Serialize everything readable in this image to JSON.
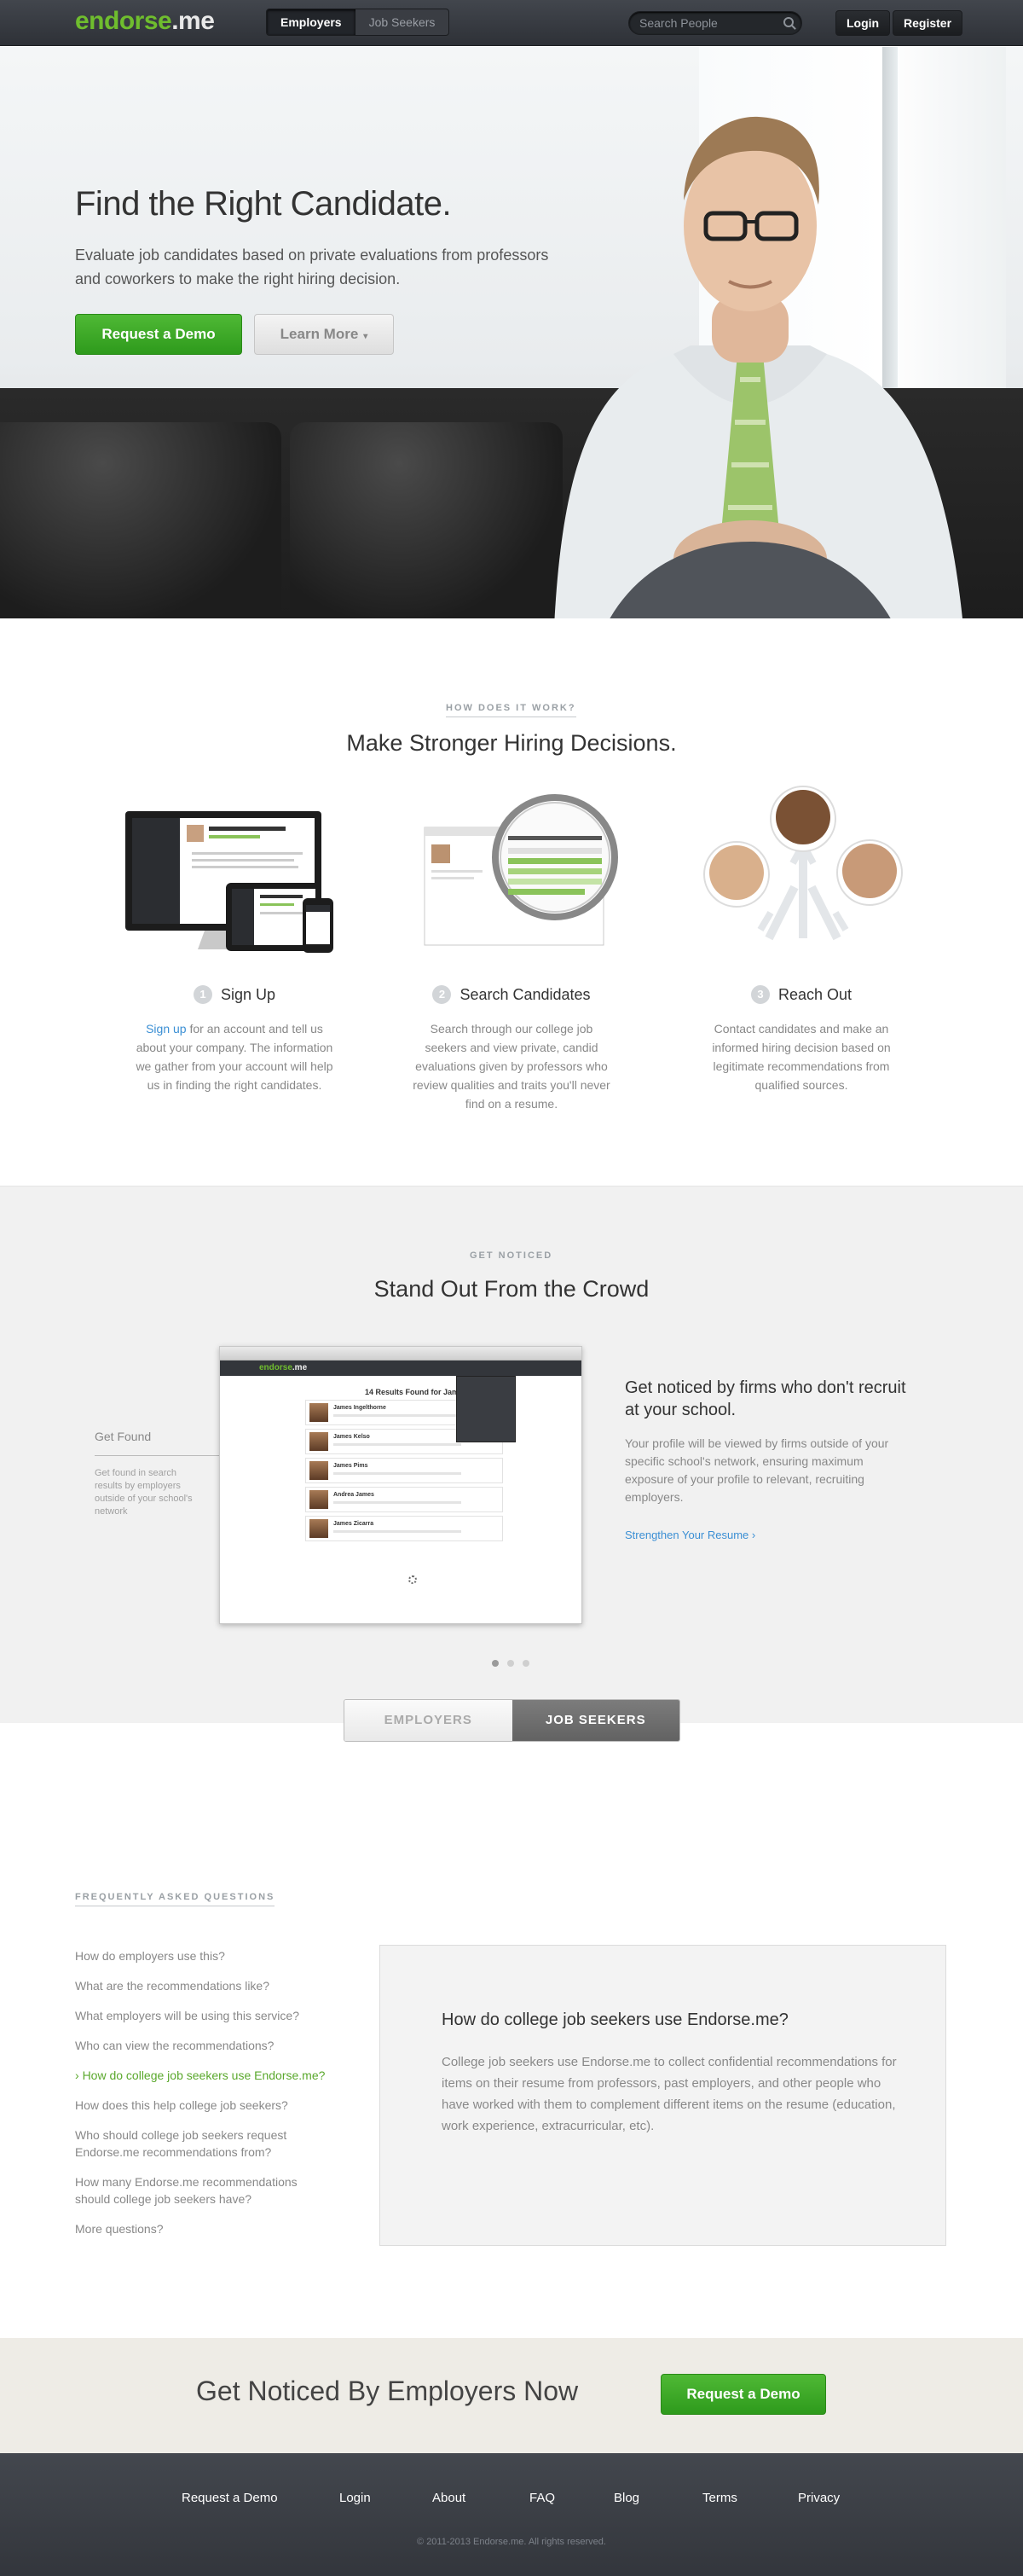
{
  "nav": {
    "logo_main": "endorse",
    "logo_dot": ".me",
    "tab_employers": "Employers",
    "tab_jobseekers": "Job Seekers",
    "search_placeholder": "Search People",
    "login": "Login",
    "register": "Register"
  },
  "hero": {
    "title": "Find the Right Candidate.",
    "subtitle": "Evaluate job candidates based on private evaluations from professors and coworkers to make the right hiring decision.",
    "demo_button": "Request a Demo",
    "learn_button": "Learn More"
  },
  "how": {
    "kicker": "HOW DOES IT WORK?",
    "title": "Make Stronger Hiring Decisions.",
    "steps": [
      {
        "num": "1",
        "title": "Sign Up",
        "link": "Sign up",
        "desc": " for an account and tell us about your company.  The information we gather from your account will help us in finding the right candidates."
      },
      {
        "num": "2",
        "title": "Search Candidates",
        "desc": "Search through our college job seekers and view private, candid evaluations given by professors who review qualities and traits you'll never find on a resume."
      },
      {
        "num": "3",
        "title": "Reach Out",
        "desc": "Contact candidates and make an informed hiring decision based on legitimate recommendations from qualified sources."
      }
    ]
  },
  "noticed": {
    "kicker": "GET NOTICED",
    "title": "Stand Out From the Crowd",
    "get_found": "Get Found",
    "get_found_desc": "Get found in search results by employers outside of your school's network",
    "mini_logo": "endorse",
    "mini_logo_dot": ".me",
    "results_title": "14 Results Found for James",
    "result_names": [
      "James Ingelthorne",
      "James Kelso",
      "James Pims",
      "Andrea James",
      "James Zicarra"
    ],
    "side_title": "Get noticed by firms who don't recruit at your school.",
    "side_desc": "Your profile will be viewed by firms outside of your specific school's network, ensuring maximum exposure of your profile to relevant, recruiting employers.",
    "side_link": "Strengthen Your Resume",
    "toggle_employers": "EMPLOYERS",
    "toggle_jobseekers": "JOB SEEKERS"
  },
  "faq": {
    "kicker": "FREQUENTLY ASKED QUESTIONS",
    "questions": [
      "How do employers use this?",
      "What are the recommendations like?",
      "What employers will be using this service?",
      "Who can view the recommendations?",
      "How do college job seekers use Endorse.me?",
      "How does this help college job seekers?",
      "Who should college job seekers request Endorse.me recommendations from?",
      "How many Endorse.me recommendations should college job seekers have?",
      "More questions?"
    ],
    "active_index": 4,
    "answer_title": "How do college job seekers use Endorse.me?",
    "answer_text": "College job seekers use Endorse.me to collect confidential recommendations for items on their resume from professors, past employers, and other people who have worked with them to complement different items on the resume (education, work experience, extracurricular, etc)."
  },
  "cta": {
    "text": "Get Noticed By Employers Now",
    "button": "Request a Demo"
  },
  "footer": {
    "links": [
      "Request a Demo",
      "Login",
      "About",
      "FAQ",
      "Blog",
      "Terms",
      "Privacy"
    ],
    "copyright": "© 2011-2013  Endorse.me.  All rights reserved."
  },
  "colors": {
    "brand_green": "#6fbd2e",
    "link_blue": "#3b8fd4",
    "nav_dark": "#33363b"
  }
}
